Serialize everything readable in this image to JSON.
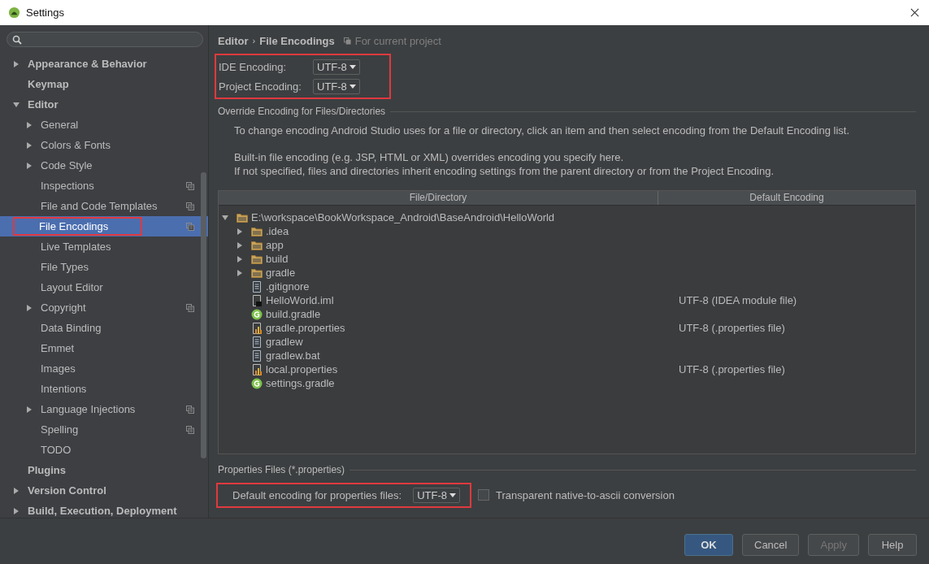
{
  "window": {
    "title": "Settings"
  },
  "sidebar": {
    "items": [
      {
        "label": "Appearance & Behavior",
        "expanded": false,
        "selected": false,
        "highlighted": false
      },
      {
        "label": "Keymap",
        "selected": false,
        "highlighted": false
      },
      {
        "label": "Editor",
        "expanded": true,
        "selected": false,
        "highlighted": false,
        "children": [
          {
            "label": "General",
            "expanded": false,
            "selected": false,
            "highlighted": false,
            "project_level": false
          },
          {
            "label": "Colors & Fonts",
            "expanded": false,
            "selected": false,
            "highlighted": false,
            "project_level": false
          },
          {
            "label": "Code Style",
            "expanded": false,
            "selected": false,
            "highlighted": false,
            "project_level": false
          },
          {
            "label": "Inspections",
            "selected": false,
            "highlighted": false,
            "project_level": true
          },
          {
            "label": "File and Code Templates",
            "selected": false,
            "highlighted": false,
            "project_level": true
          },
          {
            "label": "File Encodings",
            "selected": true,
            "highlighted": true,
            "project_level": true
          },
          {
            "label": "Live Templates",
            "selected": false,
            "highlighted": false,
            "project_level": false
          },
          {
            "label": "File Types",
            "selected": false,
            "highlighted": false,
            "project_level": false
          },
          {
            "label": "Layout Editor",
            "selected": false,
            "highlighted": false,
            "project_level": false
          },
          {
            "label": "Copyright",
            "expanded": false,
            "selected": false,
            "highlighted": false,
            "project_level": true
          },
          {
            "label": "Data Binding",
            "selected": false,
            "highlighted": false,
            "project_level": false
          },
          {
            "label": "Emmet",
            "selected": false,
            "highlighted": false,
            "project_level": false
          },
          {
            "label": "Images",
            "selected": false,
            "highlighted": false,
            "project_level": false
          },
          {
            "label": "Intentions",
            "selected": false,
            "highlighted": false,
            "project_level": false
          },
          {
            "label": "Language Injections",
            "expanded": false,
            "selected": false,
            "highlighted": false,
            "project_level": true
          },
          {
            "label": "Spelling",
            "selected": false,
            "highlighted": false,
            "project_level": true
          },
          {
            "label": "TODO",
            "selected": false,
            "highlighted": false,
            "project_level": false
          }
        ]
      },
      {
        "label": "Plugins",
        "selected": false,
        "highlighted": false
      },
      {
        "label": "Version Control",
        "expanded": false,
        "selected": false,
        "highlighted": false
      },
      {
        "label": "Build, Execution, Deployment",
        "expanded": false,
        "selected": false,
        "highlighted": false
      }
    ]
  },
  "breadcrumb": {
    "parent": "Editor",
    "separator": "›",
    "current": "File Encodings",
    "scope": "For current project"
  },
  "encodings": {
    "highlighted": true,
    "rows": [
      {
        "label": "IDE Encoding:",
        "value": "UTF-8"
      },
      {
        "label": "Project Encoding:",
        "value": "UTF-8"
      }
    ]
  },
  "override": {
    "title": "Override Encoding for Files/Directories",
    "paragraphs": [
      "To change encoding Android Studio uses for a file or directory, click an item and then select encoding from the Default Encoding list.",
      "Built-in file encoding (e.g. JSP, HTML or XML) overrides encoding you specify here.\nIf not specified, files and directories inherit encoding settings from the parent directory or from the Project Encoding."
    ],
    "table": {
      "columns": [
        "File/Directory",
        "Default Encoding"
      ],
      "rows": [
        {
          "name": "E:\\workspace\\BookWorkspace_Android\\BaseAndroid\\HelloWorld",
          "kind": "folder",
          "expanded": true,
          "children": [
            {
              "name": ".idea",
              "kind": "folder",
              "expanded": false
            },
            {
              "name": "app",
              "kind": "folder",
              "expanded": false
            },
            {
              "name": "build",
              "kind": "folder",
              "expanded": false
            },
            {
              "name": "gradle",
              "kind": "folder",
              "expanded": false
            },
            {
              "name": ".gitignore",
              "kind": "text"
            },
            {
              "name": "HelloWorld.iml",
              "kind": "module",
              "encoding": "UTF-8 (IDEA module file)"
            },
            {
              "name": "build.gradle",
              "kind": "gradle"
            },
            {
              "name": "gradle.properties",
              "kind": "properties",
              "encoding": "UTF-8 (.properties file)"
            },
            {
              "name": "gradlew",
              "kind": "text"
            },
            {
              "name": "gradlew.bat",
              "kind": "text"
            },
            {
              "name": "local.properties",
              "kind": "properties",
              "encoding": "UTF-8 (.properties file)"
            },
            {
              "name": "settings.gradle",
              "kind": "gradle"
            }
          ]
        }
      ]
    }
  },
  "properties": {
    "title": "Properties Files (*.properties)",
    "highlighted": true,
    "label": "Default encoding for properties files:",
    "value": "UTF-8",
    "transparent": {
      "label": "Transparent native-to-ascii conversion",
      "checked": false
    }
  },
  "buttons": [
    {
      "label": "OK",
      "default": true,
      "disabled": false
    },
    {
      "label": "Cancel",
      "default": false,
      "disabled": false
    },
    {
      "label": "Apply",
      "default": false,
      "disabled": true
    },
    {
      "label": "Help",
      "default": false,
      "disabled": false
    }
  ]
}
